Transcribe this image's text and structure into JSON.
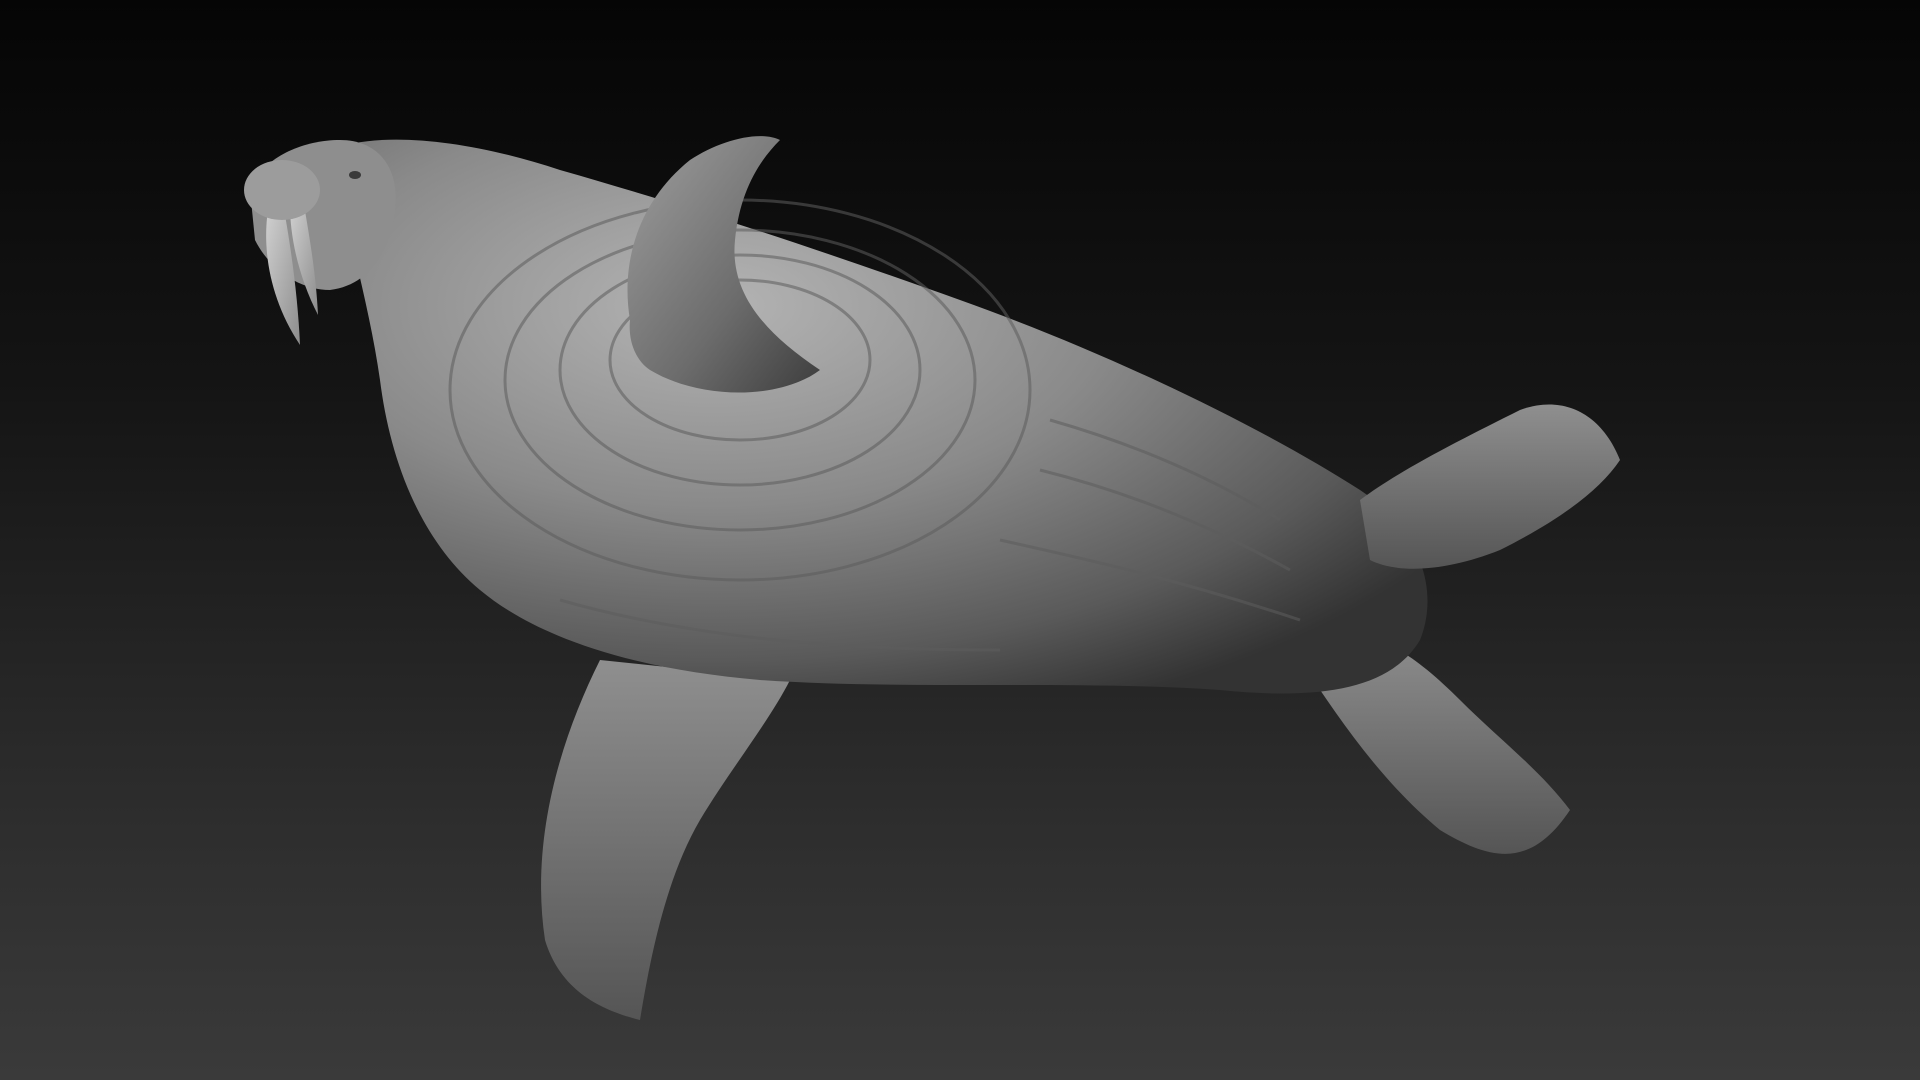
{
  "scene": {
    "subject": "walrus-sculpt",
    "material": "matcap-gray",
    "colors": {
      "background_top": "#050505",
      "background_bottom": "#3a3a3a",
      "body_light": "#a9a9a9",
      "body_mid": "#7d7d7d",
      "body_dark": "#3e3e3e",
      "tusk": "#b6b6b6"
    }
  }
}
